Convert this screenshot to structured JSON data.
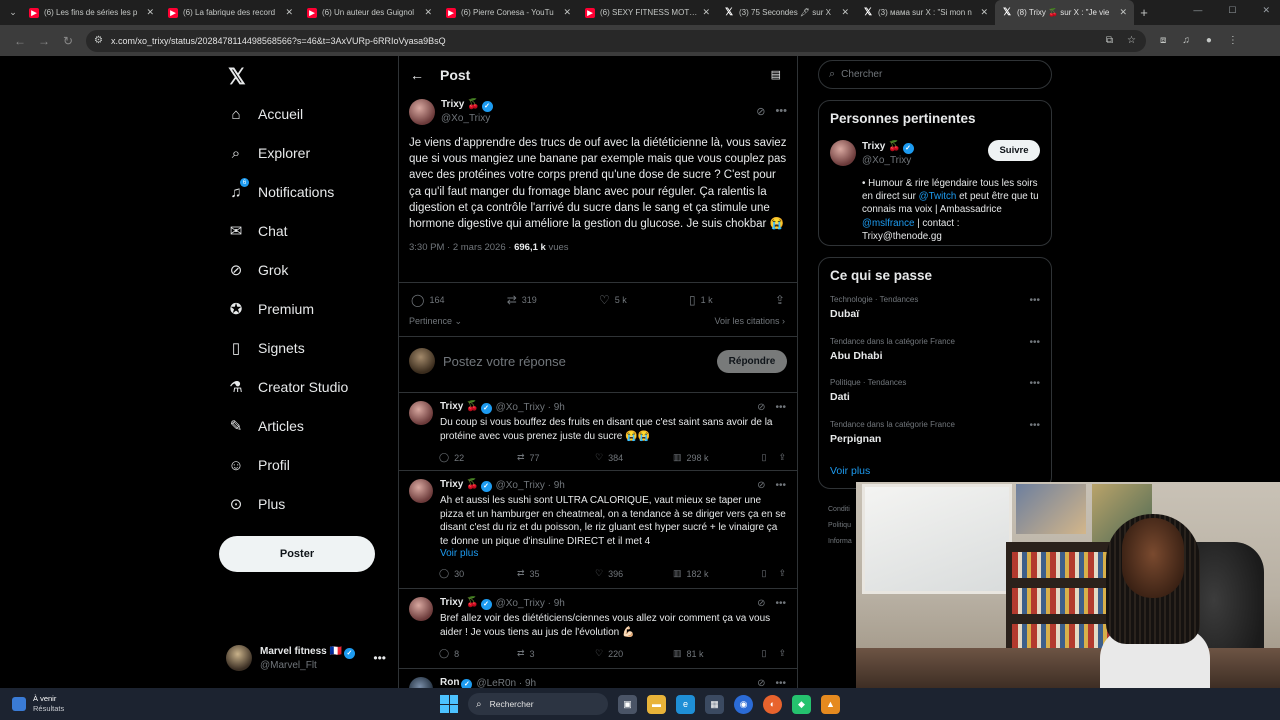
{
  "browser": {
    "tabs": [
      {
        "title": "(6) Les fins de séries les p",
        "favicon": "youtube"
      },
      {
        "title": "(6) La fabrique des record",
        "favicon": "youtube"
      },
      {
        "title": "(6) Un auteur des Guignol",
        "favicon": "youtube"
      },
      {
        "title": "(6) Pierre Conesa - YouTu",
        "favicon": "youtube"
      },
      {
        "title": "(6) SEXY FITNESS MOTIVA",
        "favicon": "youtube"
      },
      {
        "title": "(3) 75 Secondes 🖋 sur X",
        "favicon": "x"
      },
      {
        "title": "(3) мама sur X : \"Si mon n",
        "favicon": "x"
      },
      {
        "title": "(8) Trixy 🍒 sur X : \"Je vie",
        "favicon": "x",
        "active": true
      }
    ],
    "url": "x.com/xo_trixy/status/2028478114498568566?s=46&t=3AxVURp-6RRIoVyasa9BsQ"
  },
  "sidebar": {
    "items": [
      {
        "label": "Accueil",
        "icon": "home-icon"
      },
      {
        "label": "Explorer",
        "icon": "search-icon"
      },
      {
        "label": "Notifications",
        "icon": "bell-icon",
        "badge": "6"
      },
      {
        "label": "Chat",
        "icon": "mail-icon"
      },
      {
        "label": "Grok",
        "icon": "grok-icon"
      },
      {
        "label": "Premium",
        "icon": "verified-icon"
      },
      {
        "label": "Signets",
        "icon": "bookmark-icon"
      },
      {
        "label": "Creator Studio",
        "icon": "flask-icon"
      },
      {
        "label": "Articles",
        "icon": "article-icon"
      },
      {
        "label": "Profil",
        "icon": "person-icon"
      },
      {
        "label": "Plus",
        "icon": "more-circle-icon"
      }
    ],
    "post_button": "Poster",
    "account": {
      "name": "Marvel fitness 🇫🇷",
      "handle": "@Marvel_Flt"
    }
  },
  "main": {
    "header_title": "Post",
    "post": {
      "author": "Trixy 🍒",
      "handle": "@Xo_Trixy",
      "text": "Je viens d'apprendre des trucs de ouf avec la diététicienne là, vous saviez que si vous mangiez une banane par exemple mais que vous couplez pas avec des protéines votre corps prend qu'une dose de sucre ? C'est pour ça qu'il faut manger du fromage blanc avec pour réguler. Ça ralentis la digestion et ça contrôle l'arrivé du sucre dans le sang et ça stimule une hormone digestive qui améliore la gestion du glucose. Je suis chokbar 😭",
      "time": "3:30 PM · 2 mars 2026",
      "views_count": "696,1 k",
      "views_label": "vues",
      "stats": {
        "replies": "164",
        "reposts": "319",
        "likes": "5 k",
        "bookmarks": "1 k"
      },
      "relevance": "Pertinence",
      "citations": "Voir les citations"
    },
    "reply_placeholder": "Postez votre réponse",
    "reply_button": "Répondre",
    "replies": [
      {
        "author": "Trixy 🍒",
        "handle": "@Xo_Trixy · 9h",
        "text": "Du coup si vous bouffez des fruits en disant que c'est saint sans avoir de la protéine avec vous prenez juste du sucre 😭😭",
        "more": "",
        "replies": "22",
        "reposts": "77",
        "likes": "384",
        "views": "298 k"
      },
      {
        "author": "Trixy 🍒",
        "handle": "@Xo_Trixy · 9h",
        "text": "Ah et aussi les sushi sont ULTRA CALORIQUE, vaut mieux se taper une pizza et un hamburger en cheatmeal, on a tendance à se diriger vers ça en se disant c'est du riz et du poisson, le riz gluant est hyper sucré + le vinaigre ça te donne un pique d'insuline DIRECT et il met 4",
        "more": "Voir plus",
        "replies": "30",
        "reposts": "35",
        "likes": "396",
        "views": "182 k"
      },
      {
        "author": "Trixy 🍒",
        "handle": "@Xo_Trixy · 9h",
        "text": "Bref allez voir des diététiciens/ciennes vous allez voir comment ça va vous aider ! Je vous tiens au jus de l'évolution 💪🏻",
        "more": "",
        "replies": "8",
        "reposts": "3",
        "likes": "220",
        "views": "81 k"
      },
      {
        "author": "Ron",
        "handle": "@LeR0n · 9h",
        "text": "",
        "more": "",
        "replies": "",
        "reposts": "",
        "likes": "",
        "views": ""
      }
    ]
  },
  "right": {
    "search_placeholder": "Chercher",
    "relevant_title": "Personnes pertinentes",
    "person": {
      "name": "Trixy 🍒",
      "handle": "@Xo_Trixy",
      "follow": "Suivre",
      "bio_1": "• Humour & rire légendaire tous les soirs en direct sur ",
      "bio_link1": "@Twitch",
      "bio_2": " et peut être que tu connais ma voix | Ambassadrice ",
      "bio_link2": "@mslfrance",
      "bio_3": " | contact : Trixy@thenode.gg"
    },
    "happening_title": "Ce qui se passe",
    "trends": [
      {
        "context": "Technologie · Tendances",
        "name": "Dubaï"
      },
      {
        "context": "Tendance dans la catégorie France",
        "name": "Abu Dhabi"
      },
      {
        "context": "Politique · Tendances",
        "name": "Dati"
      },
      {
        "context": "Tendance dans la catégorie France",
        "name": "Perpignan"
      }
    ],
    "show_more": "Voir plus",
    "footer": [
      "Conditi",
      "Politiqu",
      "Informa"
    ]
  },
  "taskbar": {
    "weather_title": "À venir",
    "weather_sub": "Résultats",
    "search_label": "Rechercher"
  },
  "colors": {
    "accent": "#1d9bf0",
    "background": "#000000",
    "text": "#e7e9ea",
    "muted": "#71767b",
    "border": "#2f3336"
  }
}
